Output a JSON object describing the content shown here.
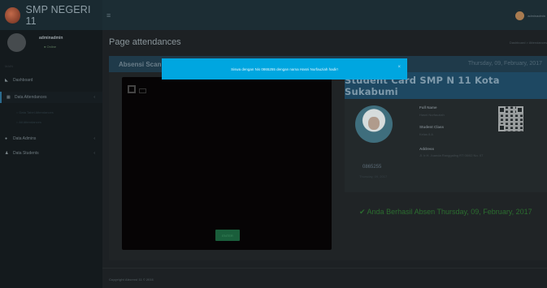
{
  "app": {
    "brand": "SMP NEGERI 11",
    "menu_icon": "bars-icon"
  },
  "topbar": {
    "username": "adminadmin"
  },
  "sidebar": {
    "user": {
      "name": "adminadmin",
      "status": "● Online"
    },
    "header": "MAIN",
    "items": [
      {
        "icon": "dashboard-icon",
        "label": "Dashboard",
        "caret": ""
      },
      {
        "icon": "calendar-icon",
        "label": "Data Attendances",
        "caret": "‹"
      },
      {
        "icon": "user-icon",
        "label": "Data Admins",
        "caret": "‹"
      },
      {
        "icon": "users-icon",
        "label": "Data Students",
        "caret": "‹"
      }
    ],
    "subitems": [
      "○ Data Tabel Attendances",
      "○ All Attendances"
    ]
  },
  "page": {
    "title": "Page attendances",
    "breadcrumb": "Dashboard > Attendances"
  },
  "panel": {
    "title": "Absensi Scan",
    "date": "Thursday, 09, February, 2017",
    "enter_label": "ENTER"
  },
  "card": {
    "title": "Student Card SMP N 11 Kota Sukabumi",
    "nis": "0865255",
    "nis_date": "Thursday, 09, 2017",
    "full_name_label": "Full Name",
    "full_name": "Hasni Nurfauziah",
    "class_label": "Student Class",
    "class_value": "Kelas 8 A",
    "address_label": "Address",
    "address_value": "Jl. Ir.H. Juanda Ranggaling RT 05/02 No. 07"
  },
  "success": {
    "icon": "✔",
    "message": "Anda Berhasil Absen Thursday, 09, February, 2017"
  },
  "footer": {
    "text": "Copyright Absensi 11 © 2016"
  },
  "alert": {
    "text": "Siswa dengan Nis 0865255 dengan nama Hasni Nurfauziah hadir!",
    "close": "×"
  }
}
